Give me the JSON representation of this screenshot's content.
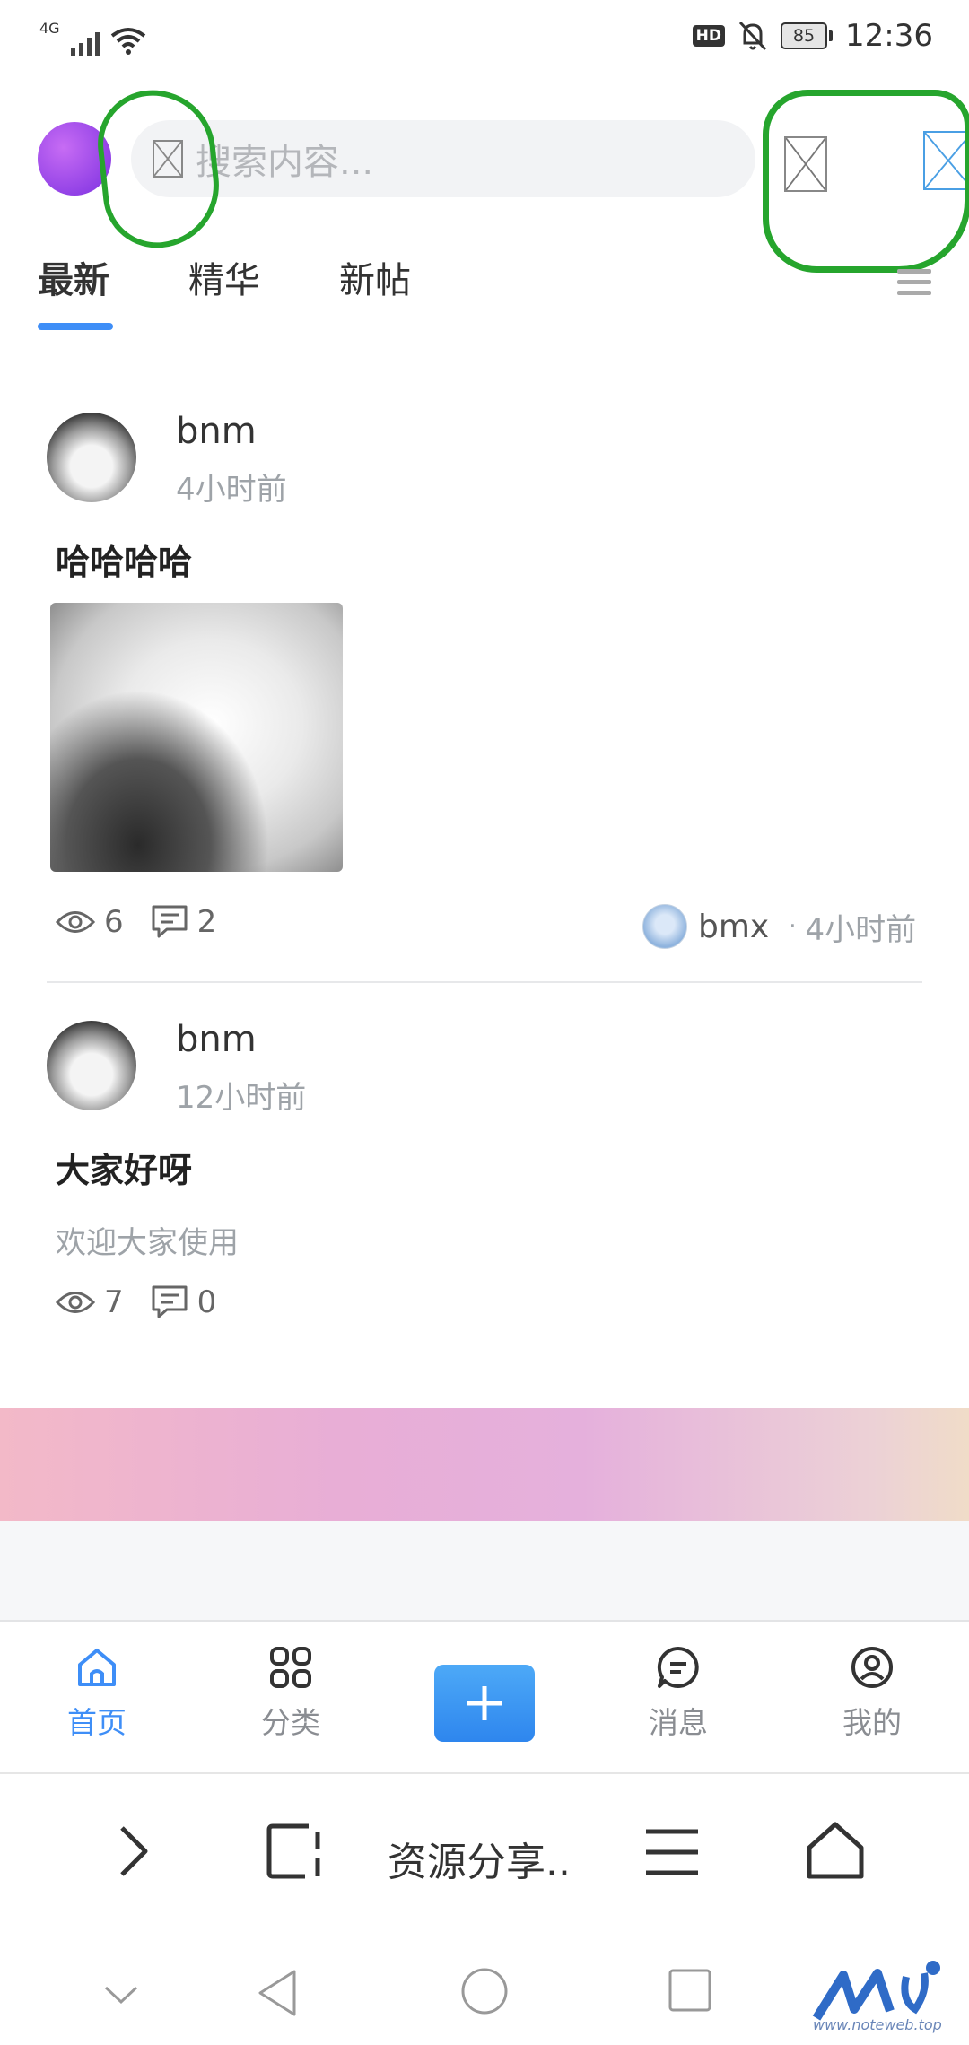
{
  "status_bar": {
    "network": "4G",
    "hd": "HD",
    "battery": "85",
    "time": "12:36"
  },
  "header": {
    "search_placeholder": "搜索内容..."
  },
  "tabs": [
    {
      "label": "最新",
      "active": true
    },
    {
      "label": "精华",
      "active": false
    },
    {
      "label": "新帖",
      "active": false
    }
  ],
  "posts": [
    {
      "user": "bnm",
      "time": "4小时前",
      "title": "哈哈哈哈",
      "views": "6",
      "comments": "2",
      "reply_user": "bmx",
      "reply_sep": "·",
      "reply_time": "4小时前"
    },
    {
      "user": "bnm",
      "time": "12小时前",
      "title": "大家好呀",
      "excerpt": "欢迎大家使用",
      "views": "7",
      "comments": "0"
    }
  ],
  "tabbar": {
    "home": "首页",
    "category": "分类",
    "messages": "消息",
    "mine": "我的"
  },
  "browser": {
    "title": "资源分享.."
  },
  "watermark": "www.noteweb.top",
  "colors": {
    "accent": "#3e8ef7",
    "annotation": "#26a52d"
  }
}
